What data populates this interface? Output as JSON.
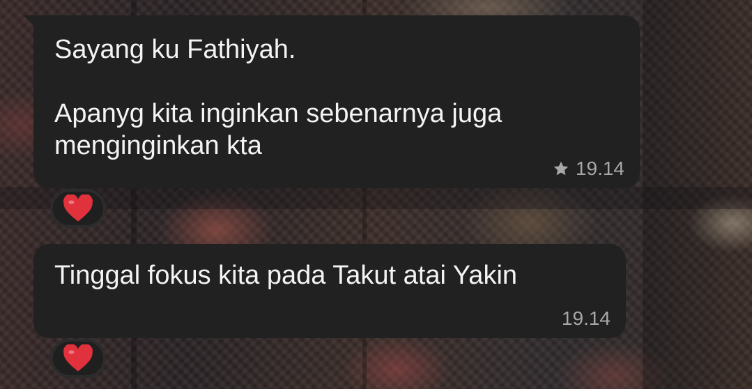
{
  "messages": [
    {
      "text": "Sayang ku Fathiyah.\n\nApanyg kita inginkan sebenarnya juga\nmenginginkan kta",
      "time": "19.14",
      "starred": true,
      "reaction": "heart-icon"
    },
    {
      "text": "Tinggal fokus kita pada Takut atai Yakin",
      "time": "19.14",
      "starred": false,
      "reaction": "heart-icon"
    }
  ],
  "colors": {
    "bubble": "#212121",
    "text": "#f4f4f4",
    "meta": "#a8a8a8",
    "heart": "#e0313c"
  }
}
